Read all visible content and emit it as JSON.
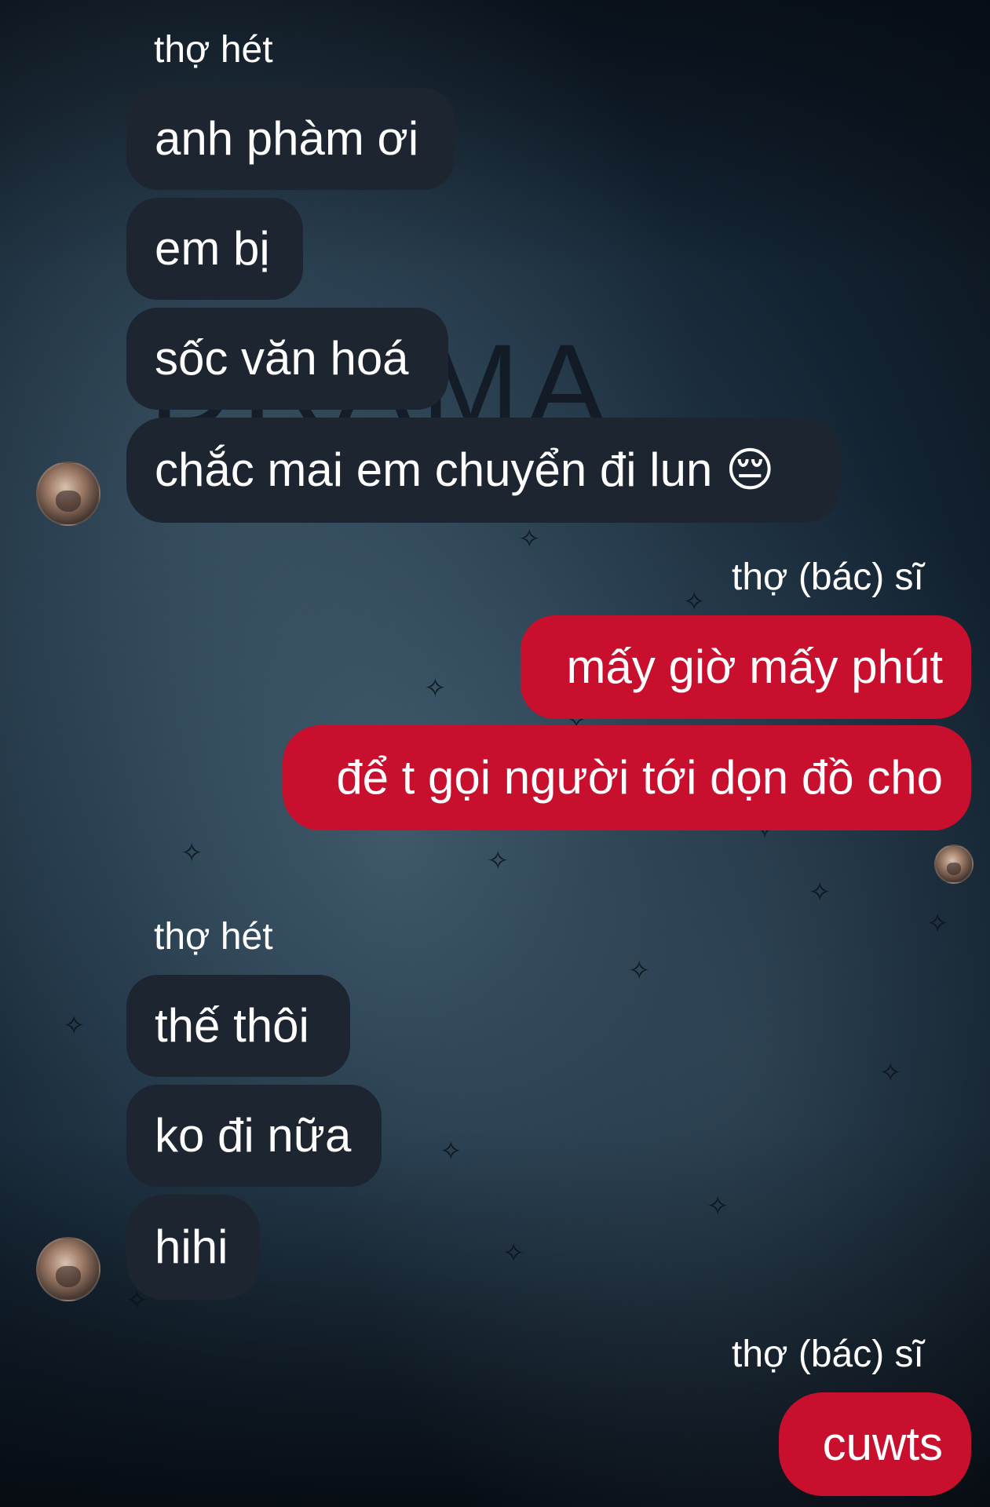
{
  "background": {
    "title_text": "DRAMA"
  },
  "messages": [
    {
      "sender": "thợ hét",
      "side": "in",
      "bubbles": [
        "anh phàm ơi",
        "em bị",
        "sốc văn hoá",
        "chắc mai em chuyển đi lun 😔"
      ]
    },
    {
      "sender": "thợ (bác) sĩ",
      "side": "out",
      "bubbles": [
        "mấy giờ mấy phút",
        "để t gọi người tới dọn đồ cho"
      ]
    },
    {
      "sender": "thợ hét",
      "side": "in",
      "bubbles": [
        "thế thôi",
        "ko đi nữa",
        "hihi"
      ]
    },
    {
      "sender": "thợ (bác) sĩ",
      "side": "out",
      "bubbles": [
        "cuwts"
      ]
    }
  ],
  "colors": {
    "incoming_bubble": "#1d2530",
    "outgoing_bubble": "#c8102e",
    "text": "#ffffff"
  },
  "icons": {
    "avatar": "user-avatar-icon",
    "birds": "bird-silhouette-icon"
  }
}
